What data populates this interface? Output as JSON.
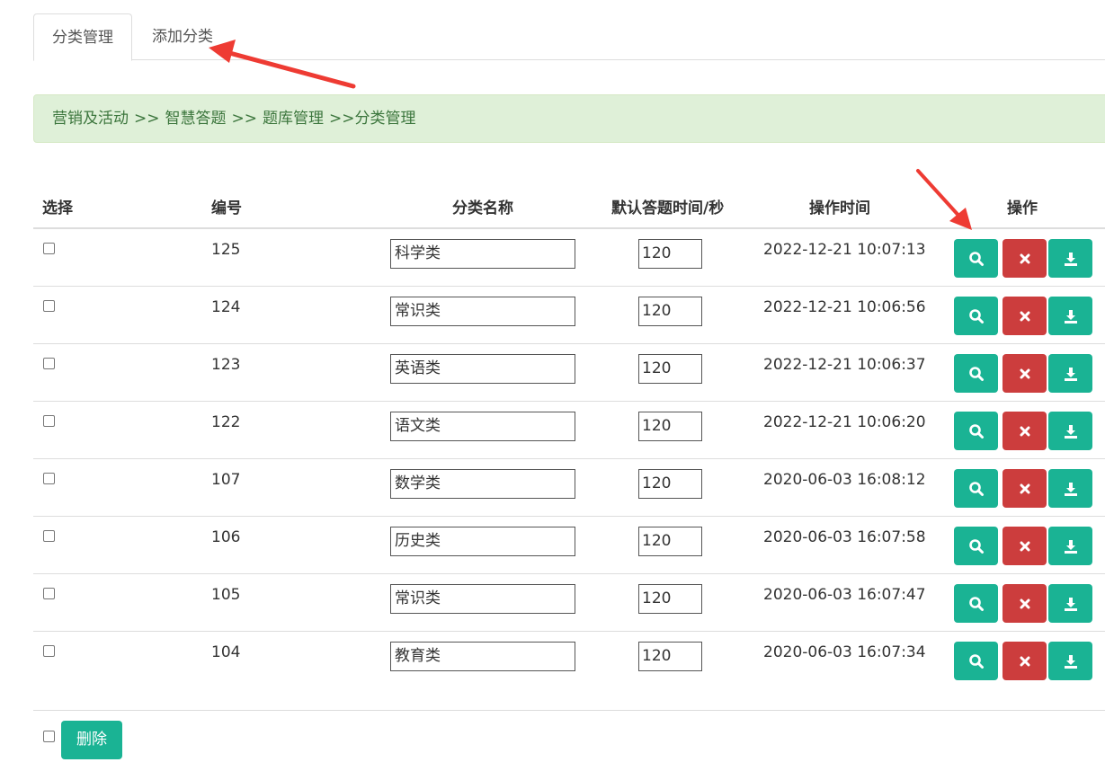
{
  "tabs": [
    {
      "label": "分类管理",
      "active": true
    },
    {
      "label": "添加分类",
      "active": false
    }
  ],
  "breadcrumb": {
    "items": [
      "营销及活动",
      "智慧答题",
      "题库管理",
      "分类管理"
    ],
    "separator": ">>"
  },
  "table": {
    "headers": {
      "select": "选择",
      "id": "编号",
      "name": "分类名称",
      "default_time": "默认答题时间/秒",
      "op_time": "操作时间",
      "actions": "操作"
    },
    "rows": [
      {
        "id": "125",
        "name": "科学类",
        "time": "120",
        "op_time": "2022-12-21 10:07:13"
      },
      {
        "id": "124",
        "name": "常识类",
        "time": "120",
        "op_time": "2022-12-21 10:06:56"
      },
      {
        "id": "123",
        "name": "英语类",
        "time": "120",
        "op_time": "2022-12-21 10:06:37"
      },
      {
        "id": "122",
        "name": "语文类",
        "time": "120",
        "op_time": "2022-12-21 10:06:20"
      },
      {
        "id": "107",
        "name": "数学类",
        "time": "120",
        "op_time": "2020-06-03 16:08:12"
      },
      {
        "id": "106",
        "name": "历史类",
        "time": "120",
        "op_time": "2020-06-03 16:07:58"
      },
      {
        "id": "105",
        "name": "常识类",
        "time": "120",
        "op_time": "2020-06-03 16:07:47"
      },
      {
        "id": "104",
        "name": "教育类",
        "time": "120",
        "op_time": "2020-06-03 16:07:34"
      }
    ],
    "row_actions": [
      "search-icon",
      "close-icon",
      "download-icon"
    ]
  },
  "footer": {
    "delete_label": "删除"
  },
  "colors": {
    "primary": "#1ab394",
    "danger": "#cc3d3d",
    "breadcrumb_bg": "#dff0d8",
    "breadcrumb_text": "#3c763d",
    "annotation_arrow": "#ee3b33"
  }
}
